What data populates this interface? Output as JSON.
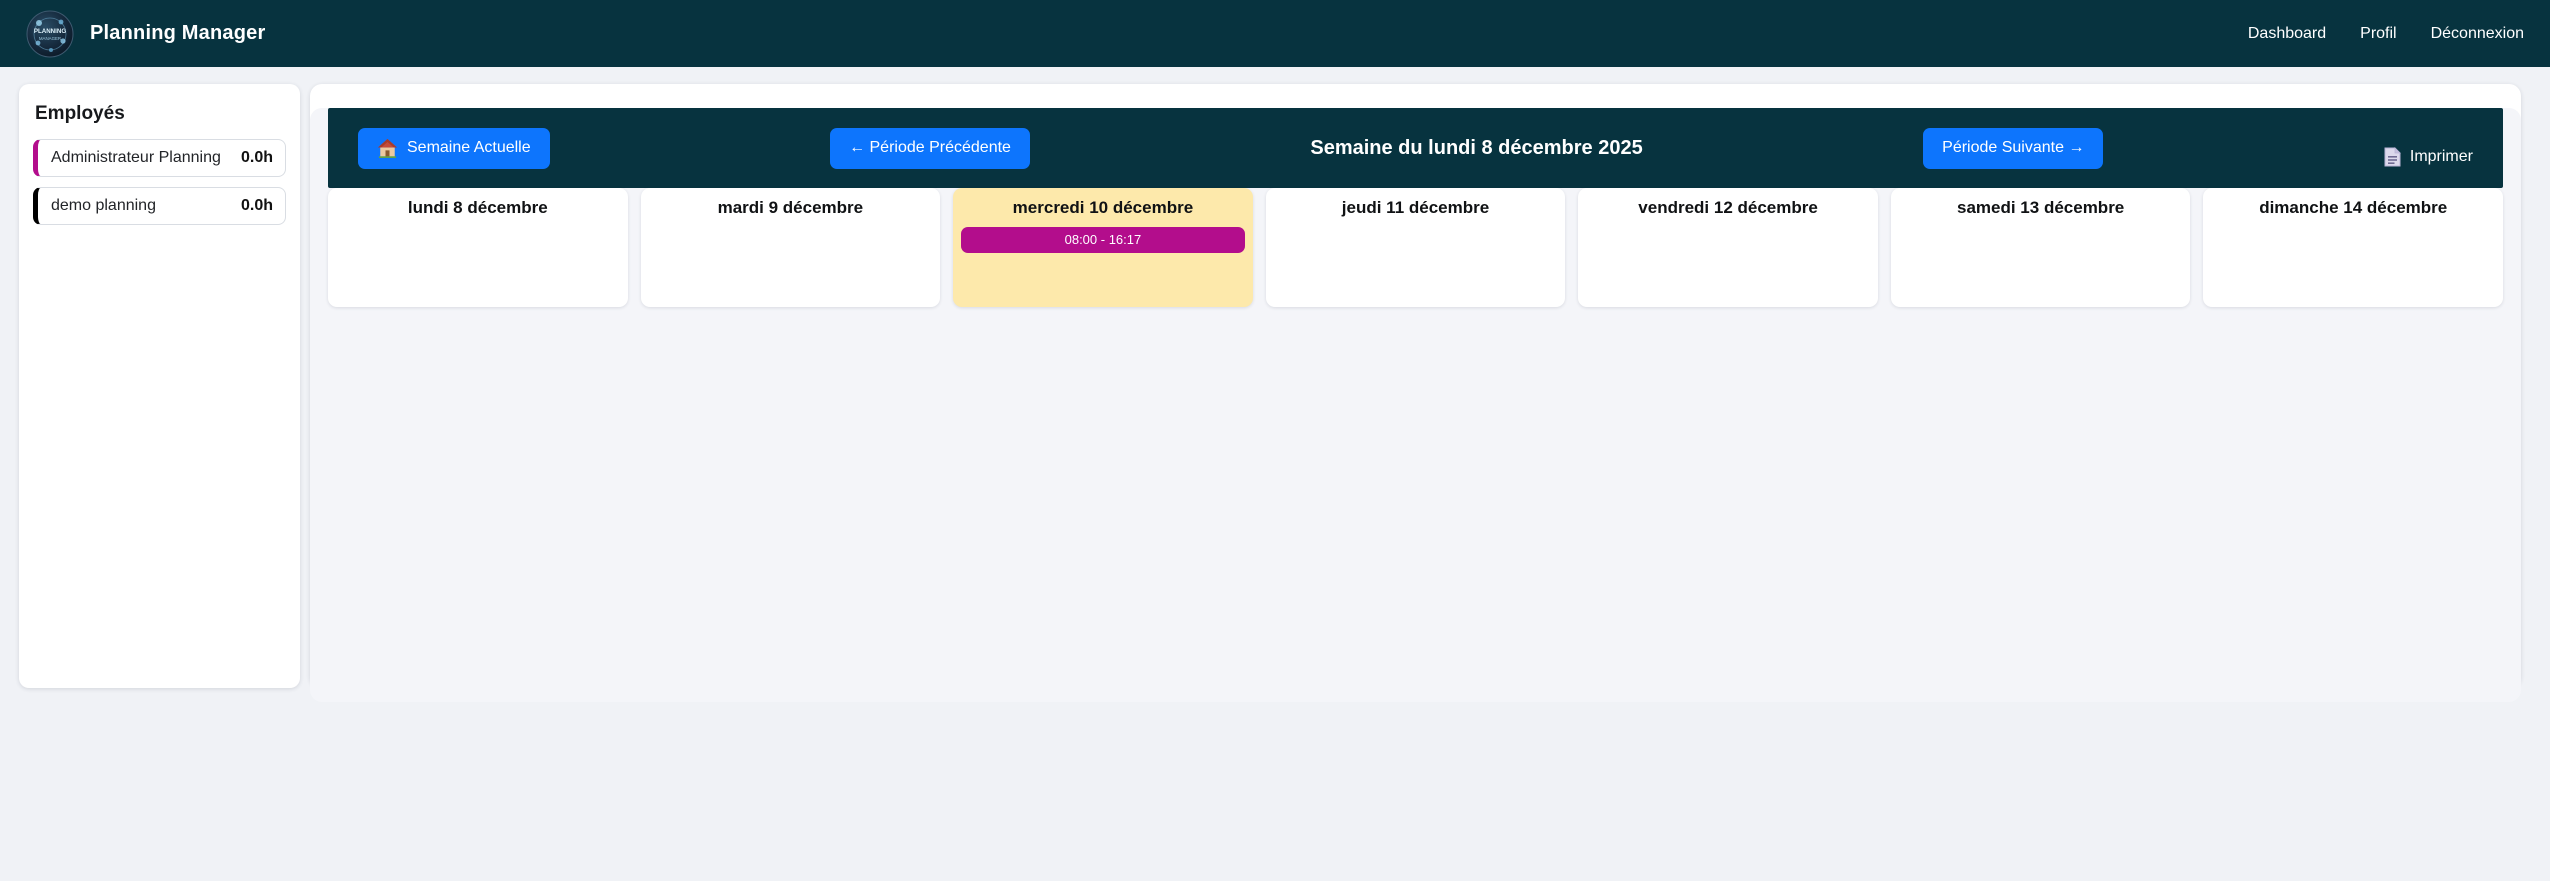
{
  "navbar": {
    "brand": "Planning Manager",
    "logo_name": "planning-manager-logo",
    "links": [
      {
        "label": "Dashboard"
      },
      {
        "label": "Profil"
      },
      {
        "label": "Déconnexion"
      }
    ]
  },
  "sidebar": {
    "title": "Employés",
    "employees": [
      {
        "name": "Administrateur Planning",
        "hours": "0.0h",
        "color": "#b30d8c"
      },
      {
        "name": "demo planning",
        "hours": "0.0h",
        "color": "#000000"
      }
    ]
  },
  "calendar": {
    "current_week_button": "Semaine Actuelle",
    "prev_button": "← Période Précédente",
    "title": "Semaine du lundi 8 décembre 2025",
    "next_button": "Période Suivante →",
    "print_label": "Imprimer",
    "days": [
      {
        "label": "lundi 8 décembre"
      },
      {
        "label": "mardi 9 décembre"
      },
      {
        "label": "mercredi 10 décembre",
        "today": true,
        "events": [
          {
            "time": "08:00 - 16:17",
            "color": "#b30d8c"
          }
        ]
      },
      {
        "label": "jeudi 11 décembre"
      },
      {
        "label": "vendredi 12 décembre"
      },
      {
        "label": "samedi 13 décembre"
      },
      {
        "label": "dimanche 14 décembre"
      }
    ]
  },
  "colors": {
    "header_dark": "#07333f",
    "accent_blue": "#0d75fd",
    "today_highlight": "#fde9ab",
    "event_magenta": "#b30d8c",
    "page_background": "#f0f2f6"
  }
}
